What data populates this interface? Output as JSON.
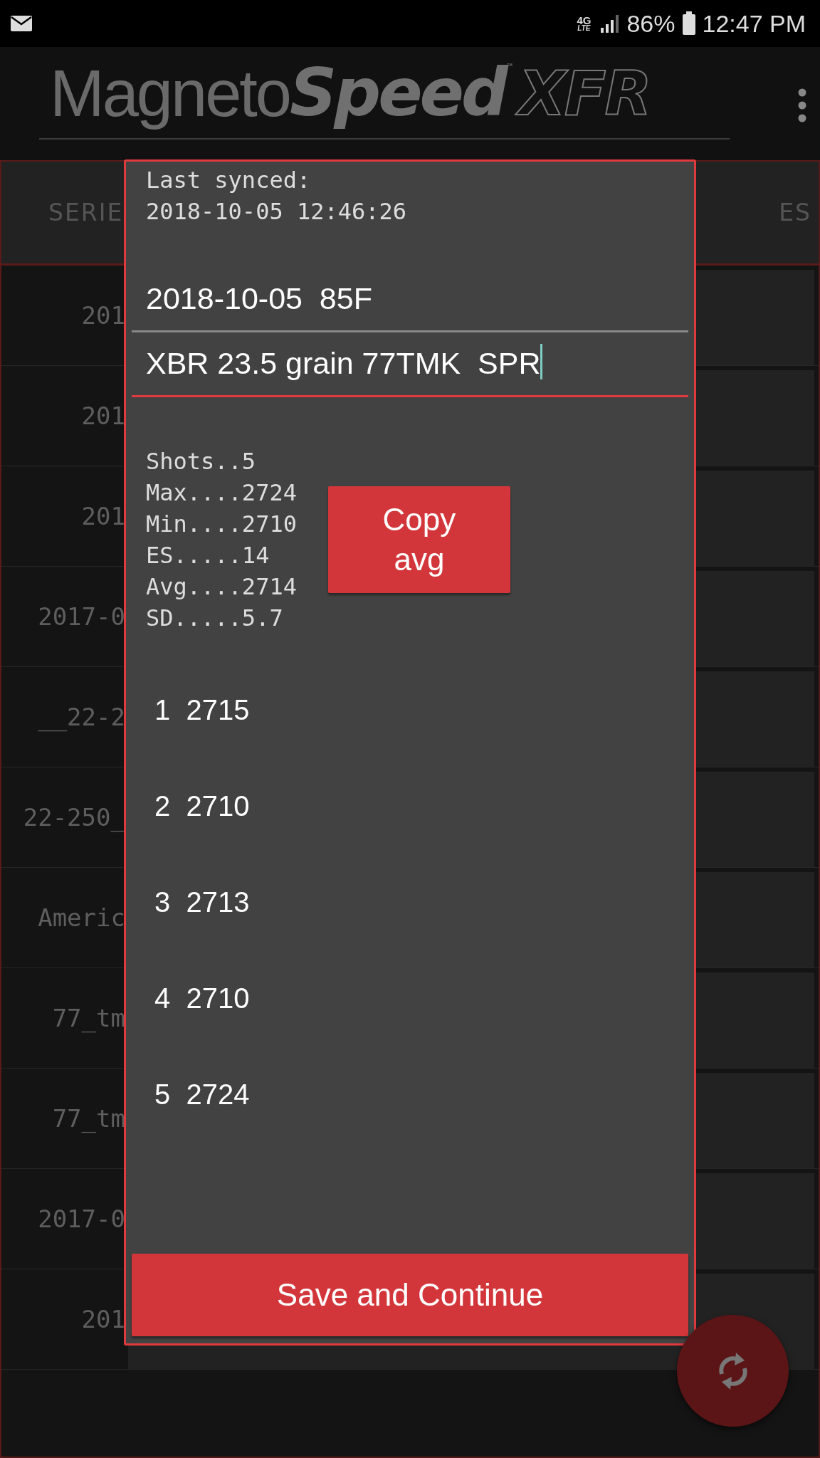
{
  "status_bar": {
    "network": "4G",
    "network_sub": "LTE",
    "battery": "86%",
    "time": "12:47 PM"
  },
  "header": {
    "logo": {
      "part_1": "Magneto",
      "part_2": "Speed",
      "trademark": "™",
      "part_3": "XFR"
    }
  },
  "table": {
    "columns": [
      "SERIE",
      "ES"
    ],
    "rows": [
      {
        "column_1": "201"
      },
      {
        "column_1": "201"
      },
      {
        "column_1": "201"
      },
      {
        "column_1": "2017-0"
      },
      {
        "column_1": "__22-2"
      },
      {
        "column_1": "22-250_"
      },
      {
        "column_1": "Americ"
      },
      {
        "column_1": "77_tm"
      },
      {
        "column_1": "77_tm"
      },
      {
        "column_1": "2017-0"
      },
      {
        "column_1": "201"
      }
    ]
  },
  "dialog": {
    "sync_label": "Last synced:",
    "sync_time": "2018-10-05 12:46:26",
    "fields": [
      {
        "value": "2018-10-05  85F",
        "focused": false
      },
      {
        "value": "XBR 23.5 grain 77TMK  SPR",
        "focused": true
      }
    ],
    "stats": [
      "Shots..5",
      "Max....2724",
      "Min....2710",
      "ES.....14",
      "Avg....2714",
      "SD.....5.7"
    ],
    "copy_button": "Copy avg",
    "shots": [
      {
        "number": "1",
        "velocity": "2715"
      },
      {
        "number": "2",
        "velocity": "2710"
      },
      {
        "number": "3",
        "velocity": "2713"
      },
      {
        "number": "4",
        "velocity": "2710"
      },
      {
        "number": "5",
        "velocity": "2724"
      }
    ],
    "save_button": "Save and Continue"
  }
}
